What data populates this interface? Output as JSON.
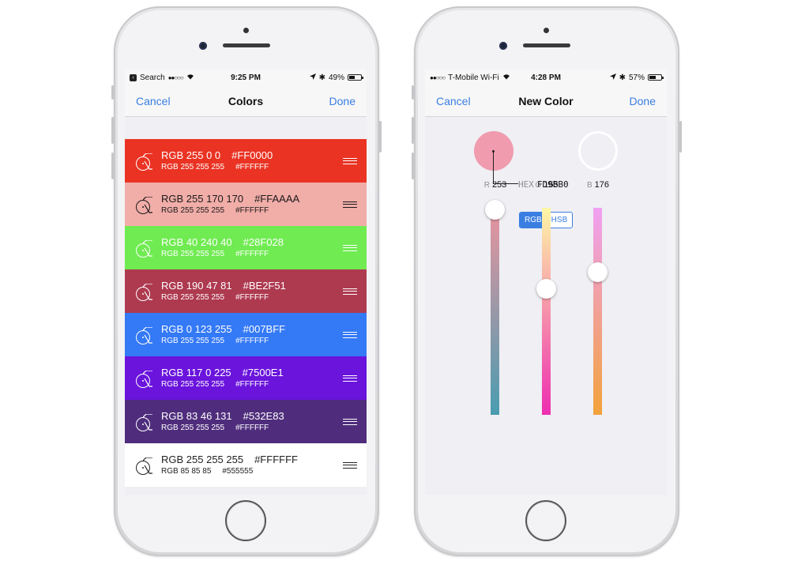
{
  "left_phone": {
    "status_bar": {
      "back_label": "Search",
      "signal": "●●○○○",
      "time": "9:25 PM",
      "battery": "49%",
      "battery_fraction": 0.49
    },
    "nav": {
      "cancel": "Cancel",
      "title": "Colors",
      "done": "Done"
    },
    "colors": [
      {
        "primary_rgb": "RGB 255 0 0",
        "primary_hex": "#FF0000",
        "secondary_rgb": "RGB 255 255 255",
        "secondary_hex": "#FFFFFF",
        "bg": "#EA3323",
        "fg": "#FFFFFF"
      },
      {
        "primary_rgb": "RGB 255 170 170",
        "primary_hex": "#FFAAAA",
        "secondary_rgb": "RGB 255 255 255",
        "secondary_hex": "#FFFFFF",
        "bg": "#F1ADA8",
        "fg": "#1A1A1A"
      },
      {
        "primary_rgb": "RGB 40 240 40",
        "primary_hex": "#28F028",
        "secondary_rgb": "RGB 255 255 255",
        "secondary_hex": "#FFFFFF",
        "bg": "#70EB52",
        "fg": "#FFFFFF"
      },
      {
        "primary_rgb": "RGB 190 47 81",
        "primary_hex": "#BE2F51",
        "secondary_rgb": "RGB 255 255 255",
        "secondary_hex": "#FFFFFF",
        "bg": "#AE3A50",
        "fg": "#FFFFFF"
      },
      {
        "primary_rgb": "RGB 0 123 255",
        "primary_hex": "#007BFF",
        "secondary_rgb": "RGB 255 255 255",
        "secondary_hex": "#FFFFFF",
        "bg": "#3479F6",
        "fg": "#FFFFFF"
      },
      {
        "primary_rgb": "RGB 117 0 225",
        "primary_hex": "#7500E1",
        "secondary_rgb": "RGB 255 255 255",
        "secondary_hex": "#FFFFFF",
        "bg": "#6A14DC",
        "fg": "#FFFFFF"
      },
      {
        "primary_rgb": "RGB 83 46 131",
        "primary_hex": "#532E83",
        "secondary_rgb": "RGB 255 255 255",
        "secondary_hex": "#FFFFFF",
        "bg": "#4F2D7C",
        "fg": "#FFFFFF"
      },
      {
        "primary_rgb": "RGB 255 255 255",
        "primary_hex": "#FFFFFF",
        "secondary_rgb": "RGB 85 85 85",
        "secondary_hex": "#555555",
        "bg": "#FFFFFF",
        "fg": "#222222"
      }
    ]
  },
  "right_phone": {
    "status_bar": {
      "signal": "●●○○○",
      "carrier": "T-Mobile Wi-Fi",
      "time": "4:28 PM",
      "battery": "57%",
      "battery_fraction": 0.57
    },
    "nav": {
      "cancel": "Cancel",
      "title": "New Color",
      "done": "Done"
    },
    "preview_color": "#F09BAE",
    "hex": {
      "label": "HEX",
      "value": "FD9BB0"
    },
    "mode_toggle": {
      "options": [
        "RGB",
        "HSB"
      ],
      "selected": "RGB"
    },
    "sliders": [
      {
        "channel": "R",
        "value": "253",
        "fraction": 0.992,
        "gradient": [
          "#E9949F",
          "#4A9CB0"
        ]
      },
      {
        "channel": "G",
        "value": "155",
        "fraction": 0.608,
        "gradient": [
          "#FEF7A6",
          "#ED2EB0"
        ]
      },
      {
        "channel": "B",
        "value": "176",
        "fraction": 0.69,
        "gradient": [
          "#F0A0F2",
          "#F2A23A"
        ]
      }
    ]
  },
  "accent_color": "#3A7EE2"
}
